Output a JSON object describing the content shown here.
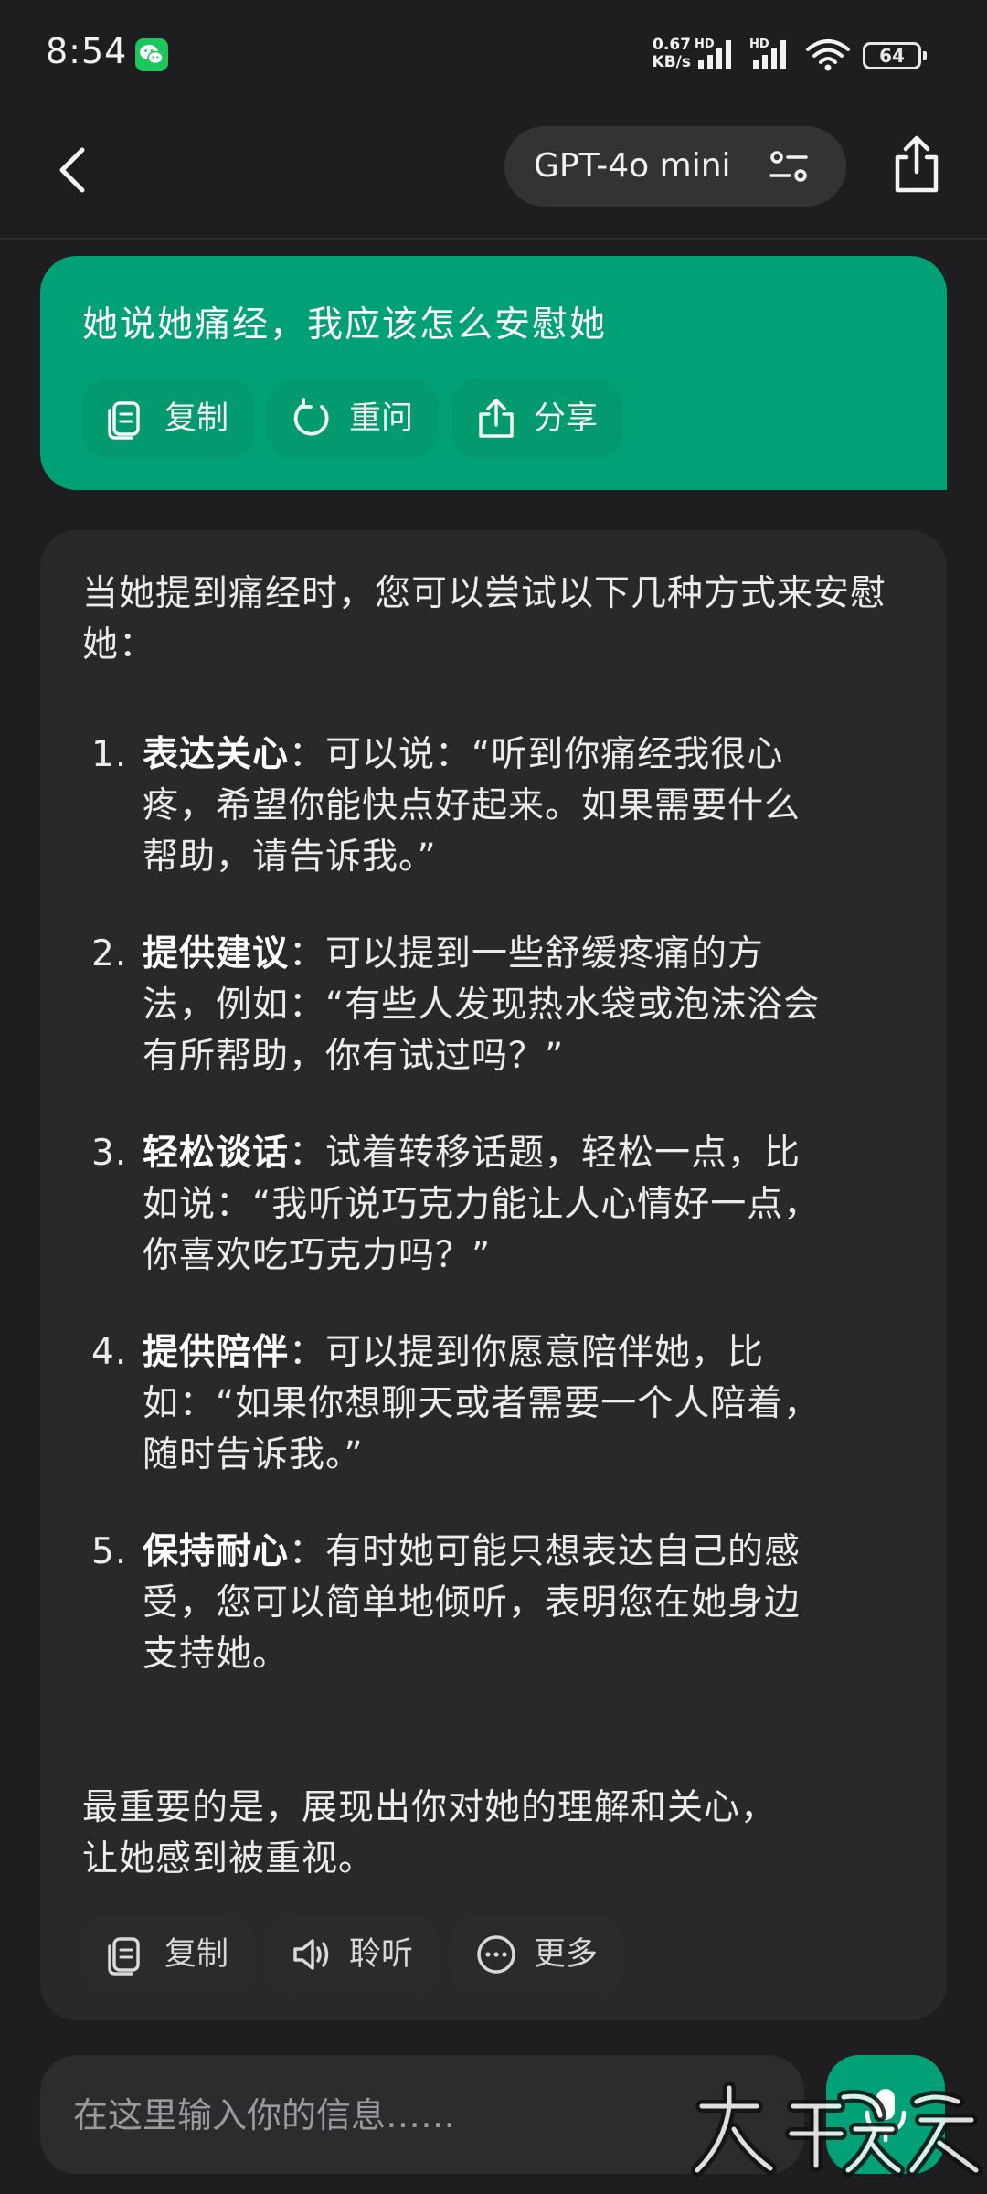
{
  "status_bar": {
    "time": "8:54",
    "net_speed_value": "0.67",
    "net_speed_unit": "KB/s",
    "signal_tag_1": "HD",
    "signal_tag_2": "HD",
    "battery": "64"
  },
  "header": {
    "model_name": "GPT-4o mini"
  },
  "user_message": {
    "text": "她说她痛经，我应该怎么安慰她",
    "actions": [
      {
        "label": "复制",
        "icon": "copy-icon"
      },
      {
        "label": "重问",
        "icon": "refresh-icon"
      },
      {
        "label": "分享",
        "icon": "share-icon"
      }
    ]
  },
  "assistant_message": {
    "intro": "当她提到痛经时，您可以尝试以下几种方式来安慰她：",
    "items": [
      {
        "num": "1.",
        "title": "表达关心",
        "line1_rest": "：可以说：“听到你痛经我很心",
        "line2": "疼，希望你能快点好起来。如果需要什么",
        "line3": "帮助，请告诉我。”"
      },
      {
        "num": "2.",
        "title": "提供建议",
        "line1_rest": "：可以提到一些舒缓疼痛的方",
        "line2": "法，例如：“有些人发现热水袋或泡沫浴会",
        "line3": "有所帮助，你有试过吗？”"
      },
      {
        "num": "3.",
        "title": "轻松谈话",
        "line1_rest": "：试着转移话题，轻松一点，比",
        "line2": "如说：“我听说巧克力能让人心情好一点，",
        "line3": "你喜欢吃巧克力吗？”"
      },
      {
        "num": "4.",
        "title": "提供陪伴",
        "line1_rest": "：可以提到你愿意陪伴她，比",
        "line2": "如：“如果你想聊天或者需要一个人陪着，",
        "line3": "随时告诉我。”"
      },
      {
        "num": "5.",
        "title": "保持耐心",
        "line1_rest": "：有时她可能只想表达自己的感",
        "line2": "受，您可以简单地倾听，表明您在她身边",
        "line3": "支持她。"
      }
    ],
    "outro_line1": "最重要的是，展现出你对她的理解和关心，",
    "outro_line2": "让她感到被重视。",
    "actions": [
      {
        "label": "复制",
        "icon": "copy-icon"
      },
      {
        "label": "聆听",
        "icon": "speaker-icon"
      },
      {
        "label": "更多",
        "icon": "more-icon"
      }
    ]
  },
  "composer": {
    "placeholder": "在这里输入你的信息……"
  },
  "colors": {
    "accent": "#02a077",
    "background": "#1e1e20",
    "bubble": "#29292c"
  }
}
